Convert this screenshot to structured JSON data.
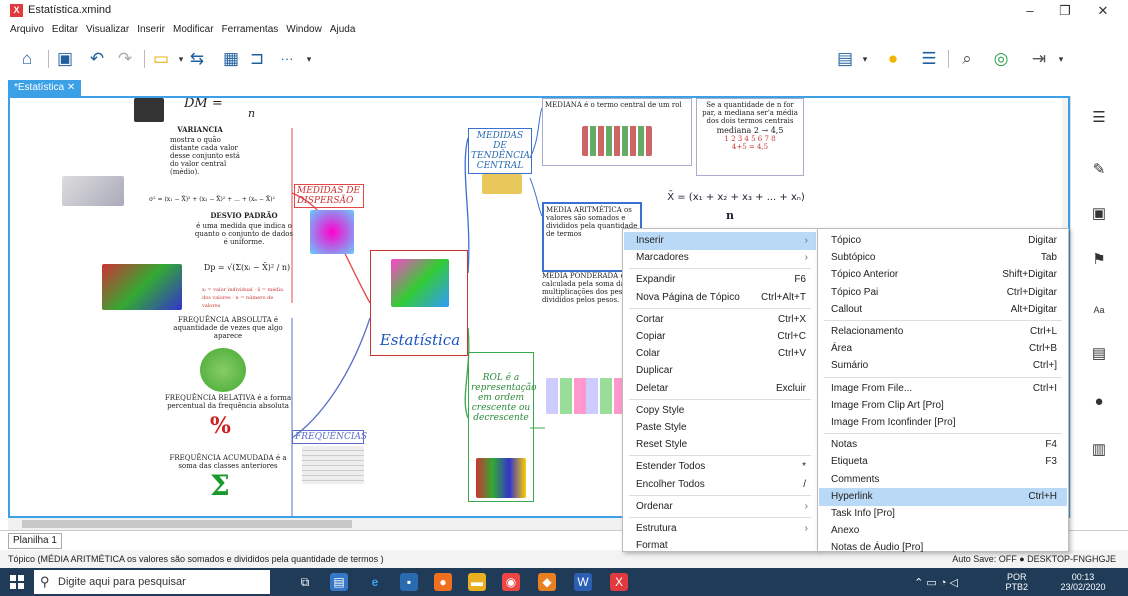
{
  "window": {
    "title": "Estatística.xmind",
    "minimize": "–",
    "maximize": "❐",
    "close": "✕"
  },
  "menu": [
    "Arquivo",
    "Editar",
    "Visualizar",
    "Inserir",
    "Modificar",
    "Ferramentas",
    "Window",
    "Ajuda"
  ],
  "toolbar": {
    "more": "···"
  },
  "tab": {
    "label": "*Estatística",
    "close": "✕"
  },
  "map": {
    "root": "Estatística",
    "medidas_dispersao": "MEDIDAS DE DISPERSÃO",
    "medidas_tendencia": "MEDIDAS DE TENDÊNCIA CENTRAL",
    "frequencias": "FREQUÊNCIAS",
    "rol": "ROL é a representação em ordem crescente ou decrescente",
    "dm_formula": "DM = ",
    "dm_den": "n",
    "variancia_title": "VARIANCIA",
    "variancia_text": "mostra o quão distante cada valor desse conjunto está do valor central (médio).",
    "variancia_formula": "σ² = (x₁ − X̄)² + (x₂ − X̄)² + ... + (xₙ − X̄)²",
    "desvio_title": "DESVIO PADRÃO",
    "desvio_text": "é uma medida que indica o quanto o conjunto de dados é uniforme.",
    "dp_formula": "Dp = √(Σ(xᵢ − X̄)² / n)",
    "dp_legend": "xᵢ = valor individual · x̄ = média dos valores · n = número de valores",
    "freq_abs": "FREQUÊNCIA ABSOLUTA é aquantidade de vezes que algo aparece",
    "freq_rel": "FREQUÊNCIA RELATIVA é a forma percentual da frequência absoluta",
    "freq_acum": "FREQUÊNCIA ACUMUDADA é a soma das classes anteriores",
    "percent_symbol": "%",
    "sigma_symbol": "Σ",
    "mediana": "MEDIANA é o termo central de um rol",
    "mediana_note": "Se a quantidade de n for par, a mediana ser'a média dos dois termos centrais",
    "mediana_ex1": "mediana 2 → 4,5",
    "mediana_ex2": "1 2 3 4 5 6 7 8",
    "mediana_ex3": "4+5 = 4,5",
    "media_arit": "MEDIA ARITMÉTICA os valores são somados e divididos pela quantidade de termos",
    "media_formula": "X̄ = (x₁ + x₂ + x₃ + ... + xₙ)",
    "media_den": "n",
    "media_pond": "MEDIA PONDERADA é calculada pela soma das multiplicações dos pesos divididos pelos pesos."
  },
  "context_menu": [
    {
      "label": "Inserir",
      "submenu": true,
      "highlight": true
    },
    {
      "label": "Marcadores",
      "submenu": true
    },
    {
      "sep": true
    },
    {
      "label": "Expandir",
      "shortcut": "F6"
    },
    {
      "label": "Nova Página de Tópico",
      "shortcut": "Ctrl+Alt+T"
    },
    {
      "sep": true
    },
    {
      "label": "Cortar",
      "shortcut": "Ctrl+X"
    },
    {
      "label": "Copiar",
      "shortcut": "Ctrl+C"
    },
    {
      "label": "Colar",
      "shortcut": "Ctrl+V"
    },
    {
      "label": "Duplicar"
    },
    {
      "label": "Deletar",
      "shortcut": "Excluir"
    },
    {
      "sep": true
    },
    {
      "label": "Copy Style"
    },
    {
      "label": "Paste Style"
    },
    {
      "label": "Reset Style"
    },
    {
      "sep": true
    },
    {
      "label": "Estender Todos",
      "shortcut": "*"
    },
    {
      "label": "Encolher Todos",
      "shortcut": "/"
    },
    {
      "sep": true
    },
    {
      "label": "Ordenar",
      "submenu": true
    },
    {
      "sep": true
    },
    {
      "label": "Estrutura",
      "submenu": true
    },
    {
      "label": "Format"
    }
  ],
  "submenu": [
    {
      "label": "Tópico",
      "shortcut": "Digitar"
    },
    {
      "label": "Subtópico",
      "shortcut": "Tab"
    },
    {
      "label": "Tópico Anterior",
      "shortcut": "Shift+Digitar"
    },
    {
      "label": "Tópico Pai",
      "shortcut": "Ctrl+Digitar"
    },
    {
      "label": "Callout",
      "shortcut": "Alt+Digitar"
    },
    {
      "sep": true
    },
    {
      "label": "Relacionamento",
      "shortcut": "Ctrl+L"
    },
    {
      "label": "Área",
      "shortcut": "Ctrl+B"
    },
    {
      "label": "Sumário",
      "shortcut": "Ctrl+]"
    },
    {
      "sep": true
    },
    {
      "label": "Image From File...",
      "shortcut": "Ctrl+I"
    },
    {
      "label": "Image From Clip Art [Pro]"
    },
    {
      "label": "Image From Iconfinder [Pro]"
    },
    {
      "sep": true
    },
    {
      "label": "Notas",
      "shortcut": "F4"
    },
    {
      "label": "Etiqueta",
      "shortcut": "F3"
    },
    {
      "label": "Comments"
    },
    {
      "label": "Hyperlink",
      "shortcut": "Ctrl+H",
      "highlight": true
    },
    {
      "label": "Task Info [Pro]"
    },
    {
      "label": "Anexo"
    },
    {
      "label": "Notas de Áudio [Pro]"
    }
  ],
  "sheet": {
    "label": "Planilha 1"
  },
  "status": {
    "left": "Tópico (MÉDIA ARITMÉTICA os valores são somados e divididos pela quantidade de termos )",
    "right": "Auto Save: OFF   ● DESKTOP-FNGHGJE"
  },
  "taskbar": {
    "search_placeholder": "Digite aqui para pesquisar",
    "lang1": "POR",
    "lang2": "PTB2",
    "time": "00:13",
    "date": "23/02/2020"
  },
  "colors": {
    "accent": "#3ca0e6",
    "highlight": "#b9d9f7",
    "taskbar": "#1f3b57",
    "root_border": "#cc3333"
  }
}
